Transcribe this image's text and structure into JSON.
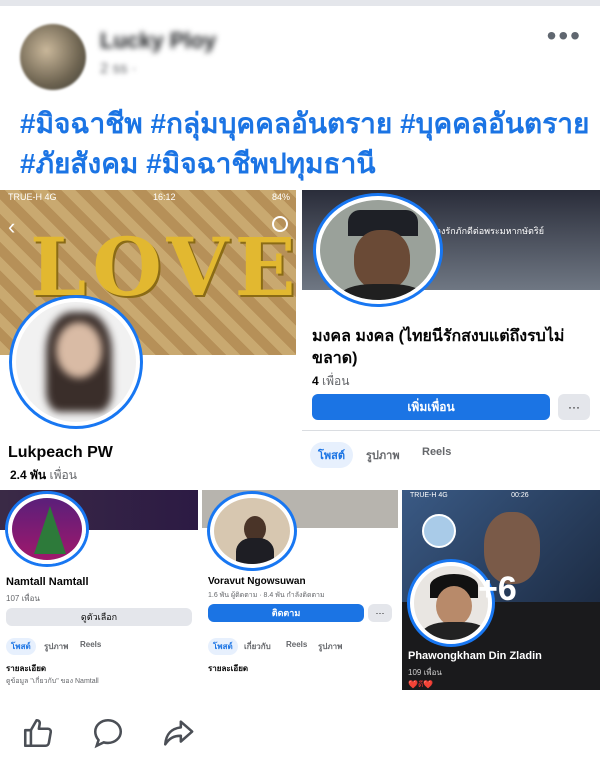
{
  "post": {
    "author_name": "Lucky Ploy",
    "meta": "2 ss ·",
    "caption_line1": "#มิจฉาชีพ #กลุ่มบุคคลอันตราย #บุคคลอันตราย",
    "caption_line2": "#ภัยสังคม #มิจฉาชีพปทุมธานี"
  },
  "tiles": {
    "t1": {
      "status_left": "TRUE-H 4G",
      "status_time": "16:12",
      "status_right": "84%",
      "love_text": "LOVE",
      "name": "Lukpeach PW",
      "friends_count": "2.4 พัน",
      "friends_label": "เพื่อน"
    },
    "t2": {
      "banner_text": "นา จงรักภักดีต่อพระมหากษัตริย์",
      "name": "มงคล มงคล (ไทยนีรักสงบแต่ถึงรบไม่ขลาด)",
      "friends_count": "4",
      "friends_label": "เพื่อน",
      "add_friend_label": "เพิ่มเพื่อน",
      "more_label": "···",
      "tabs": [
        "โพสต์",
        "รูปภาพ",
        "Reels"
      ]
    },
    "t3": {
      "name": "Namtall Namtall",
      "friends": "107 เพื่อน",
      "button_label": "ดูตัวเลือก",
      "tabs": [
        "โพสต์",
        "รูปภาพ",
        "Reels"
      ],
      "details_label": "รายละเอียด",
      "details_text": "ดูข้อมูล \"เกี่ยวกับ\" ของ Namtall"
    },
    "t4": {
      "name": "Voravut Ngowsuwan",
      "stats": "1.6 พัน ผู้ติดตาม · 8.4 พัน กำลังติดตาม",
      "button_label": "ติดตาม",
      "more_label": "···",
      "tabs": [
        "โพสต์",
        "เกี่ยวกับ",
        "Reels",
        "รูปภาพ"
      ],
      "details_label": "รายละเอียด"
    },
    "t5": {
      "status_left": "TRUE-H 4G",
      "status_time": "00:26",
      "overlay": "+6",
      "name": "Phawongkham Din Zladin",
      "friends": "109 เพื่อน",
      "reactions": "❤️ดี❤️"
    }
  },
  "actions": [
    "like-icon",
    "comment-icon",
    "share-icon"
  ],
  "colors": {
    "accent": "#1b74e4",
    "text": "#050505",
    "muted": "#65676b"
  }
}
